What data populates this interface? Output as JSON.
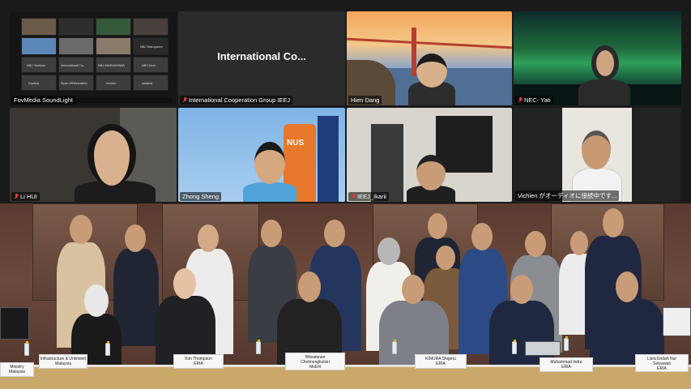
{
  "tiles": [
    {
      "id": "t1",
      "label": "FovMedia SoundLight",
      "muted": false
    },
    {
      "id": "t2",
      "label": "International Cooperation Group IEEJ",
      "muted": true,
      "center_title": "International  Co..."
    },
    {
      "id": "t3",
      "label": "Hien Dang",
      "muted": false
    },
    {
      "id": "t4",
      "label": "NEC- Yati",
      "muted": true
    },
    {
      "id": "t5",
      "label": "Li HUI",
      "muted": true
    },
    {
      "id": "t6",
      "label": "Zhong Sheng",
      "muted": false
    },
    {
      "id": "t7",
      "label": "IEEJ_Ikarii",
      "muted": true
    },
    {
      "id": "t8",
      "label": "Vichien がオーディオに接続中です...",
      "muted": false
    }
  ],
  "mini_gallery": {
    "names": [
      "NBJ Yoshida",
      "International Co...",
      "NBJ MASASHIWA",
      "NBJ Ueol",
      "Kaoliya",
      "Ryan Whiteleather",
      "vichien",
      "aaakira",
      "NBJ Maruyama"
    ]
  },
  "room": {
    "nameplates": [
      {
        "line1": "Ministry",
        "line2": "Malaysia"
      },
      {
        "line1": "Infrastructure & Unlimited",
        "line2": "Malaysia"
      },
      {
        "line1": "Kim Thompson",
        "line2": "ERIA"
      },
      {
        "line1": "Wiwatanan",
        "line2": "Chotmongkolsiri",
        "line3": "MoEN"
      },
      {
        "line1": "KIMURA Shigeru",
        "line2": "ERIA"
      },
      {
        "line1": "Muhammad Indra",
        "line2": "ERIA"
      },
      {
        "line1": "Lisra Endah Nur",
        "line2": "Setyawati",
        "line3": "ERIA"
      }
    ]
  }
}
